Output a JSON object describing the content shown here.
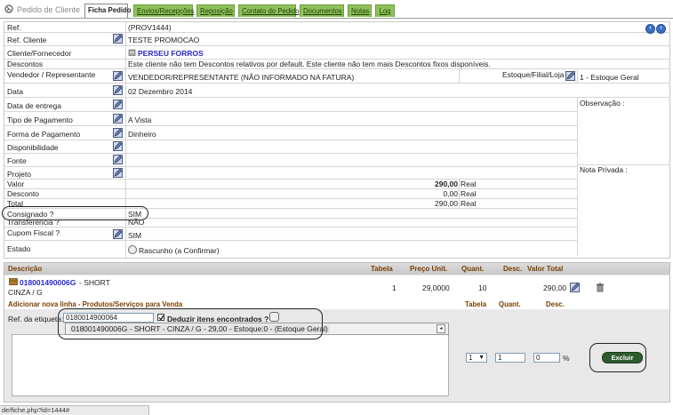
{
  "header": {
    "title": "Pedido de Cliente",
    "tabs": [
      {
        "label": "Ficha Pedido",
        "active": true
      },
      {
        "label": "Envios/Recepções",
        "active": false
      },
      {
        "label": "Reposição",
        "active": false
      },
      {
        "label": "Contato do Pedido",
        "active": false
      },
      {
        "label": "Documentos",
        "active": false
      },
      {
        "label": "Notas",
        "active": false
      },
      {
        "label": "Log",
        "active": false
      }
    ]
  },
  "card": {
    "ref_label": "Ref.",
    "ref_value": "(PROV1444)",
    "ref_cliente_label": "Ref. Cliente",
    "ref_cliente_value": "TESTE PROMOCAO",
    "cliente_label": "Cliente/Fornecedor",
    "cliente_value": "PERSEU FORROS",
    "descontos_label": "Descontos",
    "descontos_value": "Este cliente não tem Descontos relativos por default. Este cliente não tem mais Descontos fixos disponíveis.",
    "vendedor_label": "Vendedor / Representante",
    "vendedor_value": "VENDEDOR/REPRESENTANTE (NÃO INFORMADO NA FATURA)",
    "estoque_label": "Estoque/Filial/Loja",
    "estoque_value": "1 - Estoque Geral",
    "data_label": "Data",
    "data_value": "02 Dezembro 2014",
    "observacao_label": "Observação :",
    "entrega_label": "Data de entrega",
    "tipo_pagamento_label": "Tipo de Pagamento",
    "tipo_pagamento_value": "A Vista",
    "forma_pagamento_label": "Forma de Pagamento",
    "forma_pagamento_value": "Dinheiro",
    "disponibilidade_label": "Disponibilidade",
    "fonte_label": "Fonte",
    "projeto_label": "Projeto",
    "nota_privada_label": "Nota Privada :",
    "valor_label": "Valor",
    "valor_value": "290,00",
    "desconto_label": "Desconto",
    "desconto_value": "0,00",
    "total_label": "Total",
    "total_value": "290,00",
    "currency": "Real",
    "consignado_label": "Consignado ?",
    "consignado_value": "SIM",
    "transferencia_label": "Transferência ?",
    "transferencia_value": "NÃO",
    "cupom_label": "Cupom Fiscal ?",
    "cupom_value": "SIM",
    "estado_label": "Estado",
    "estado_value": "Rascunho (a Confirmar)"
  },
  "lines": {
    "headers": {
      "descricao": "Descrição",
      "tabela": "Tabela",
      "preco": "Preço Unit.",
      "quant": "Quant.",
      "desc": "Desc.",
      "valor": "Valor Total"
    },
    "item": {
      "code": "018001490006G",
      "name": " - SHORT",
      "variant": "CINZA / G",
      "tabela": "1",
      "preco": "29,0000",
      "quant": "10",
      "valor": "290,00"
    },
    "add": {
      "title": "Adicionar nova linha - Produtos/Serviços para Venda",
      "tabela": "Tabela",
      "quant": "Quant.",
      "desc": "Desc.",
      "ref_label": "Ref. da etiqueta:",
      "ref_value": "0180014900064",
      "deduzir_label": "Deduzir itens encontrados ?",
      "suggestion": "018001490006G - SHORT - CINZA / G - 29,00 - Estoque:0 - (Estoque Geral)",
      "tabela_value": "1",
      "quant_value": "1",
      "desc_value": "0",
      "percent": "%",
      "excluir_label": "Excluir"
    }
  },
  "statusbar": {
    "url": "de/fiche.php?id=1444#"
  },
  "colors": {
    "tab_green": "#8fc25c",
    "link_blue": "#2a2acc",
    "header_brown": "#7a3d00",
    "button_green": "#2e5c2e"
  }
}
